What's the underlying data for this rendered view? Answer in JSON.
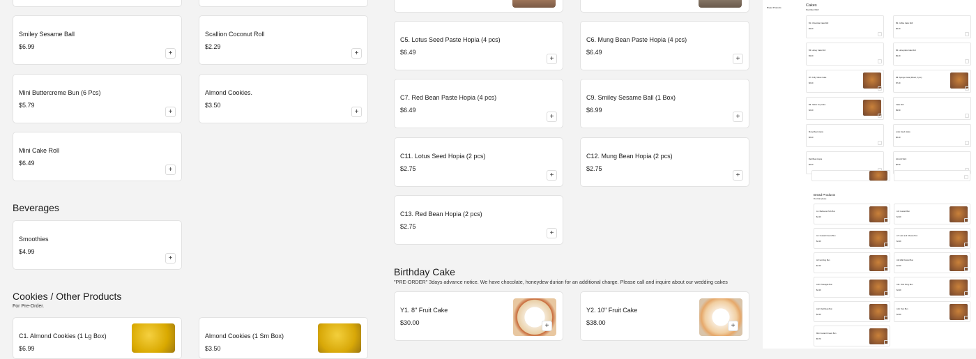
{
  "left_column": {
    "col1_cards": [
      {
        "name": "Smiley Sesame Ball",
        "price": "$6.99"
      },
      {
        "name": "Mini Buttercreme Bun (6 Pcs)",
        "price": "$5.79"
      },
      {
        "name": "Mini Cake Roll",
        "price": "$6.49"
      }
    ],
    "col2_cards": [
      {
        "name": "Scallion Coconut Roll",
        "price": "$2.29"
      },
      {
        "name": "Almond Cookies.",
        "price": "$3.50"
      }
    ],
    "beverages": {
      "title": "Beverages",
      "items": [
        {
          "name": "Smoothies",
          "price": "$4.99"
        }
      ]
    },
    "cookies": {
      "title": "Cookies / Other Products",
      "subtitle": "For Pre-Order.",
      "items": [
        {
          "name": "C1. Almond Cookies (1 Lg Box)",
          "price": "$6.99"
        },
        {
          "name": "Almond Cookies (1 Sm Box)",
          "price": "$3.50"
        }
      ]
    }
  },
  "hopia": [
    {
      "name": "C5. Lotus Seed Paste Hopia (4 pcs)",
      "price": "$6.49"
    },
    {
      "name": "C6. Mung Bean Paste Hopia (4 pcs)",
      "price": "$6.49"
    },
    {
      "name": "C7. Red Bean Paste Hopia (4 pcs)",
      "price": "$6.49"
    },
    {
      "name": "C9. Smiley Sesame Ball (1 Box)",
      "price": "$6.99"
    },
    {
      "name": "C11. Lotus Seed Hopia (2 pcs)",
      "price": "$2.75"
    },
    {
      "name": "C12. Mung Bean Hopia (2 pcs)",
      "price": "$2.75"
    },
    {
      "name": "C13. Red Bean Hopia (2 pcs)",
      "price": "$2.75"
    }
  ],
  "birthday": {
    "title": "Birthday Cake",
    "subtitle": "\"PRE-ORDER\" 3days advance notice. We have chocolate, honeydew durian for an additional charge. Please call and inquire about our wedding cakes",
    "items": [
      {
        "name": "Y1. 8\" Fruit Cake",
        "price": "$30.00"
      },
      {
        "name": "Y2. 10\" Fruit Cake",
        "price": "$38.00"
      }
    ]
  },
  "add_label": "+",
  "overview": {
    "cakes_title": "Cakes",
    "cakes_sub": "Pre-Order ONLY",
    "nav_label": "Bread Products",
    "cakes": [
      {
        "name": "B1. Chocolate Cake Roll",
        "price": "$9.49"
      },
      {
        "name": "B2. Coffee Cake Roll",
        "price": "$9.49"
      },
      {
        "name": "B3. Honey Cake Roll",
        "price": "$9.49"
      },
      {
        "name": "B4. Honeydew Cake Roll",
        "price": "$9.49"
      },
      {
        "name": "B7. Puffy Yellow Cake",
        "price": "$6.49"
      },
      {
        "name": "B8. Sponge Cake (Mixed, 5 pcs)",
        "price": "$7.49"
      },
      {
        "name": "B9. Yellow Cup Cake",
        "price": "$2.49"
      },
      {
        "name": "Cake Roll",
        "price": "$9.99"
      },
      {
        "name": "Mung Bean Hopia",
        "price": "$6.49"
      },
      {
        "name": "Lotus Seed Hopia",
        "price": "$6.49"
      },
      {
        "name": "Red Bean Hopia",
        "price": "$6.49"
      },
      {
        "name": "Almond Stick",
        "price": "$6.99"
      }
    ],
    "bread_title": "Bread Products",
    "bread_sub": "Pre-Order please",
    "bread": [
      {
        "name": "A1. Barbecue Pork Bun",
        "price": "$2.29"
      },
      {
        "name": "A3. Custard Bun",
        "price": "$2.29"
      },
      {
        "name": "A4. Custard Cream Bun",
        "price": "$2.29"
      },
      {
        "name": "A7. Ham and Cheese Bun",
        "price": "$2.29"
      },
      {
        "name": "A8. Hot Dog Bun",
        "price": "$2.29"
      },
      {
        "name": "A9. Milk Powder Bun",
        "price": "$2.29"
      },
      {
        "name": "A10. Pineapple Bun",
        "price": "$2.29"
      },
      {
        "name": "A11. Pork Song Bun",
        "price": "$2.29"
      },
      {
        "name": "A12. Red Bean Bun",
        "price": "$2.29"
      },
      {
        "name": "A14. Taro Bun",
        "price": "$2.29"
      },
      {
        "name": "Mini Custard Cream Bun",
        "price": "$5.79"
      }
    ]
  }
}
